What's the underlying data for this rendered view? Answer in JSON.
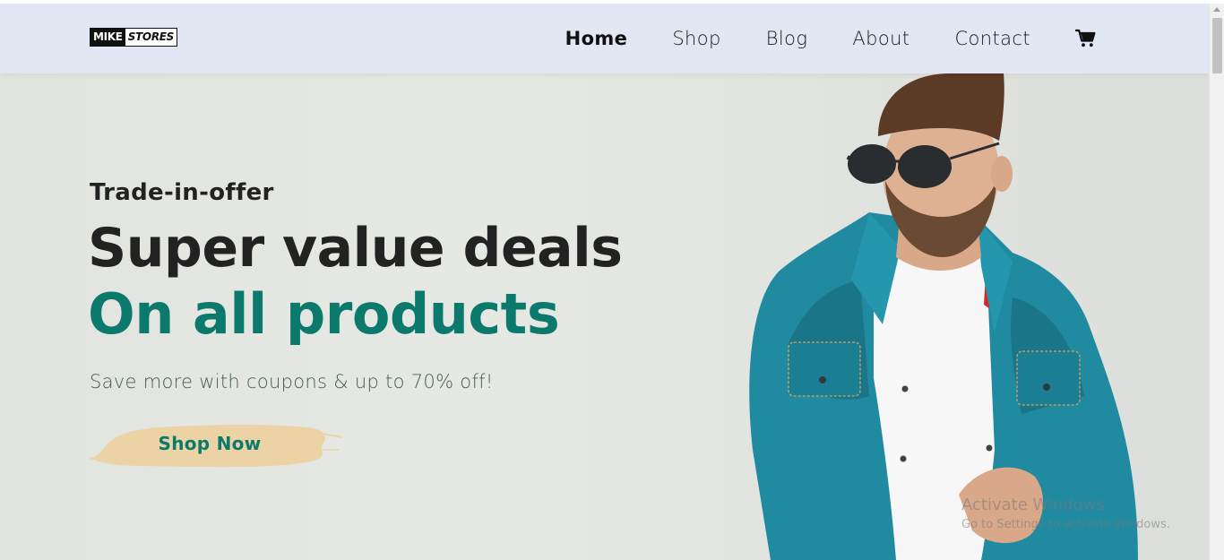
{
  "brand": {
    "logo_part1": "MIKE",
    "logo_part2": "STORES"
  },
  "nav": {
    "items": [
      {
        "label": "Home",
        "active": true
      },
      {
        "label": "Shop",
        "active": false
      },
      {
        "label": "Blog",
        "active": false
      },
      {
        "label": "About",
        "active": false
      },
      {
        "label": "Contact",
        "active": false
      }
    ],
    "cart_icon": "shopping-cart-icon"
  },
  "hero": {
    "eyebrow": "Trade-in-offer",
    "title": "Super value deals",
    "subtitle": "On all products",
    "text": "Save more with coupons & up to 70% off!",
    "cta_label": "Shop Now",
    "image": "man-in-denim-jacket-with-sunglasses"
  },
  "system_watermark": {
    "line1": "Activate Windows",
    "line2": "Go to Settings to activate Windows."
  },
  "colors": {
    "header_bg": "#e3e6f3",
    "accent": "#0b7a6c",
    "cta_brush": "#ecd3a6",
    "text_dark": "#222222"
  }
}
